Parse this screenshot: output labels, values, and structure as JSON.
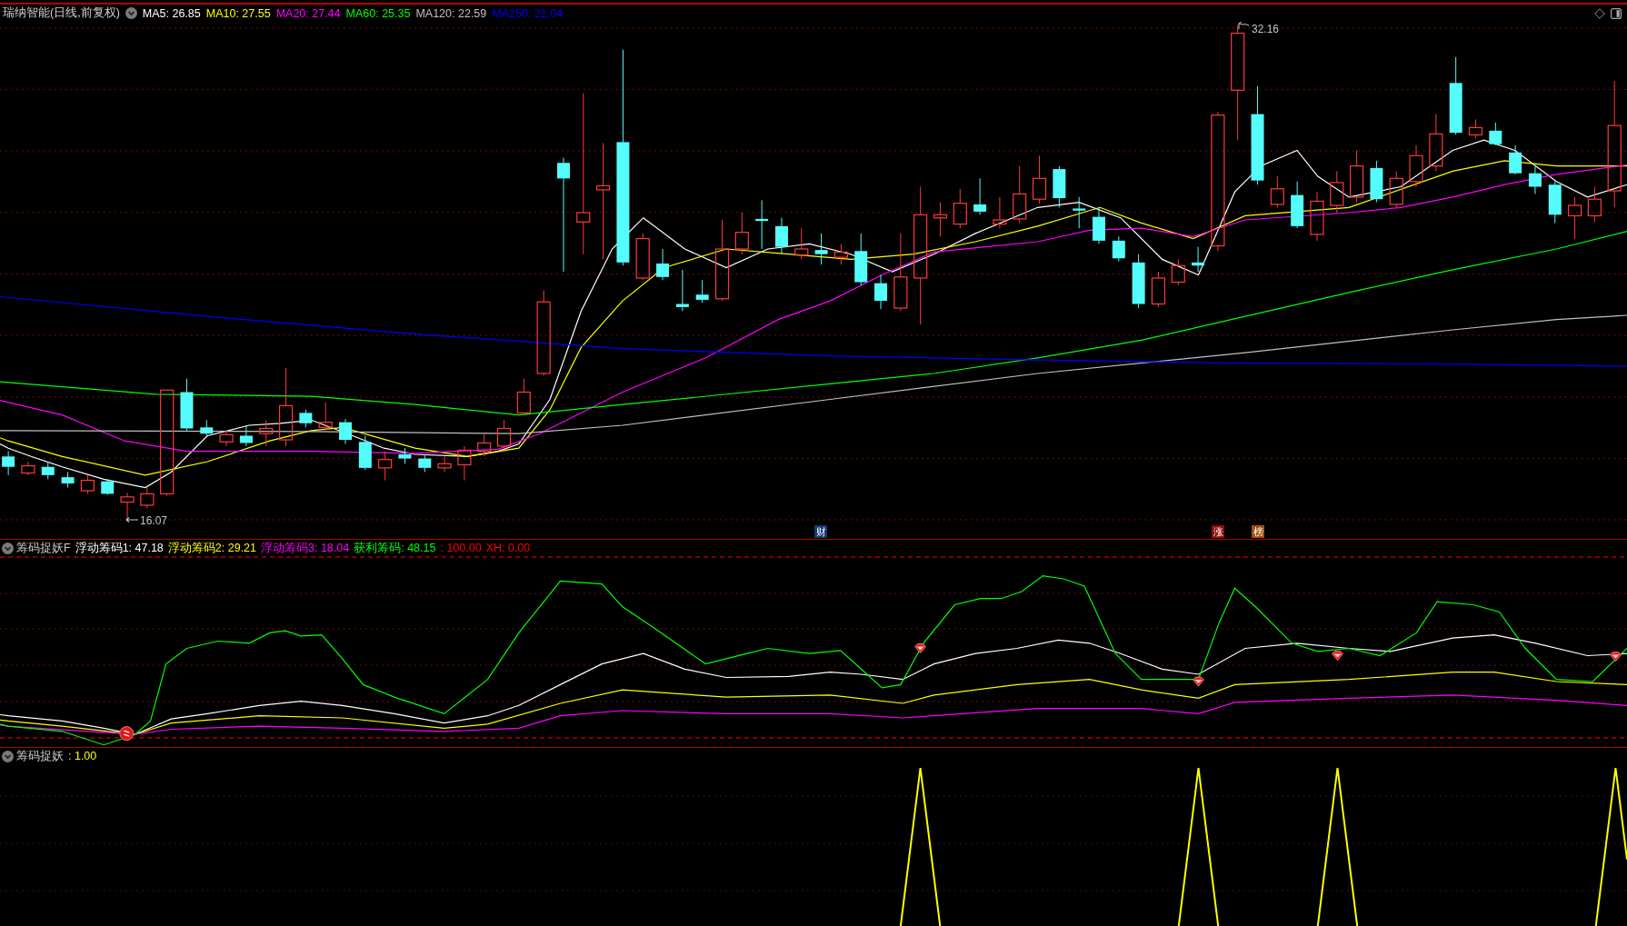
{
  "main_panel": {
    "title": "瑞纳智能(日线,前复权)",
    "indicators": [
      {
        "label": "MA5: 26.85",
        "color": "#ffffff"
      },
      {
        "label": "MA10: 27.55",
        "color": "#ffff00"
      },
      {
        "label": "MA20: 27.44",
        "color": "#ff00ff"
      },
      {
        "label": "MA60: 25.35",
        "color": "#00ff00"
      },
      {
        "label": "MA120: 22.59",
        "color": "#c0c0c0"
      },
      {
        "label": "MA250: 21.04",
        "color": "#0000ff"
      }
    ],
    "high_label": "32.16",
    "low_label": "16.07",
    "markers": [
      {
        "label": "财",
        "color": "#16386e"
      },
      {
        "label": "涨",
        "color": "#8c0c0c"
      },
      {
        "label": "榜",
        "color": "#9c520c"
      }
    ]
  },
  "chip_panel": {
    "title": "筹码捉妖F",
    "indicators": [
      {
        "label": "浮动筹码1: 47.18",
        "color": "#ffffff"
      },
      {
        "label": "浮动筹码2: 29.21",
        "color": "#ffff00"
      },
      {
        "label": "浮动筹码3: 18.04",
        "color": "#ff00ff"
      },
      {
        "label": "获利筹码: 48.15",
        "color": "#00ff00"
      },
      {
        "label": ": 100.00",
        "color": "#ff0000"
      },
      {
        "label": "XH: 0.00",
        "color": "#ff0000"
      }
    ]
  },
  "signal_panel": {
    "title": "筹码捉妖",
    "indicators": [
      {
        "label": ": 1.00",
        "color": "#ffff00"
      }
    ]
  }
}
